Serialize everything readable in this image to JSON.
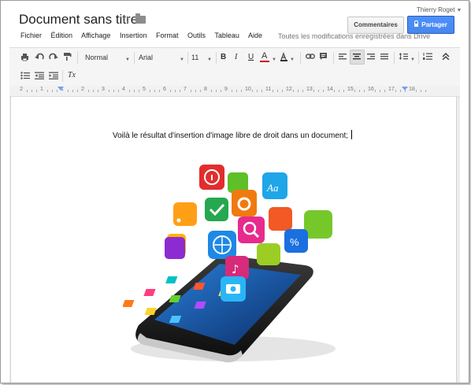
{
  "header": {
    "doc_title": "Document sans titre",
    "user_name": "Thierry Roget",
    "comments_button": "Commentaires",
    "share_button": "Partager",
    "save_status": "Toutes les modifications enregistrées dans Drive"
  },
  "menu": [
    "Fichier",
    "Édition",
    "Affichage",
    "Insertion",
    "Format",
    "Outils",
    "Tableau",
    "Aide"
  ],
  "toolbar": {
    "style_select": "Normal",
    "font_select": "Arial",
    "size_select": "11",
    "bold": "B",
    "italic": "I",
    "underline": "U",
    "text_color": "A",
    "clear_format": "Tx"
  },
  "ruler": {
    "labels": [
      "2",
      "1",
      "1",
      "2",
      "3",
      "4",
      "5",
      "6",
      "7",
      "8",
      "9",
      "10",
      "11",
      "12",
      "13",
      "14",
      "15",
      "16",
      "17",
      "18"
    ]
  },
  "document": {
    "body_text": "Voilà le résultat d'insertion d'image libre de droit dans un document;"
  },
  "colors": {
    "accent": "#4d90fe",
    "text_color_underline": "#cc0000"
  },
  "icons": [
    "star-icon",
    "folder-icon",
    "print-icon",
    "undo-icon",
    "redo-icon",
    "paint-format-icon",
    "highlight-icon",
    "link-icon",
    "comment-icon",
    "align-left-icon",
    "align-center-icon",
    "align-right-icon",
    "justify-icon",
    "line-spacing-icon",
    "numbered-list-icon",
    "collapse-icon",
    "bulleted-list-icon",
    "decrease-indent-icon",
    "increase-indent-icon",
    "clear-format-icon",
    "lock-icon"
  ]
}
